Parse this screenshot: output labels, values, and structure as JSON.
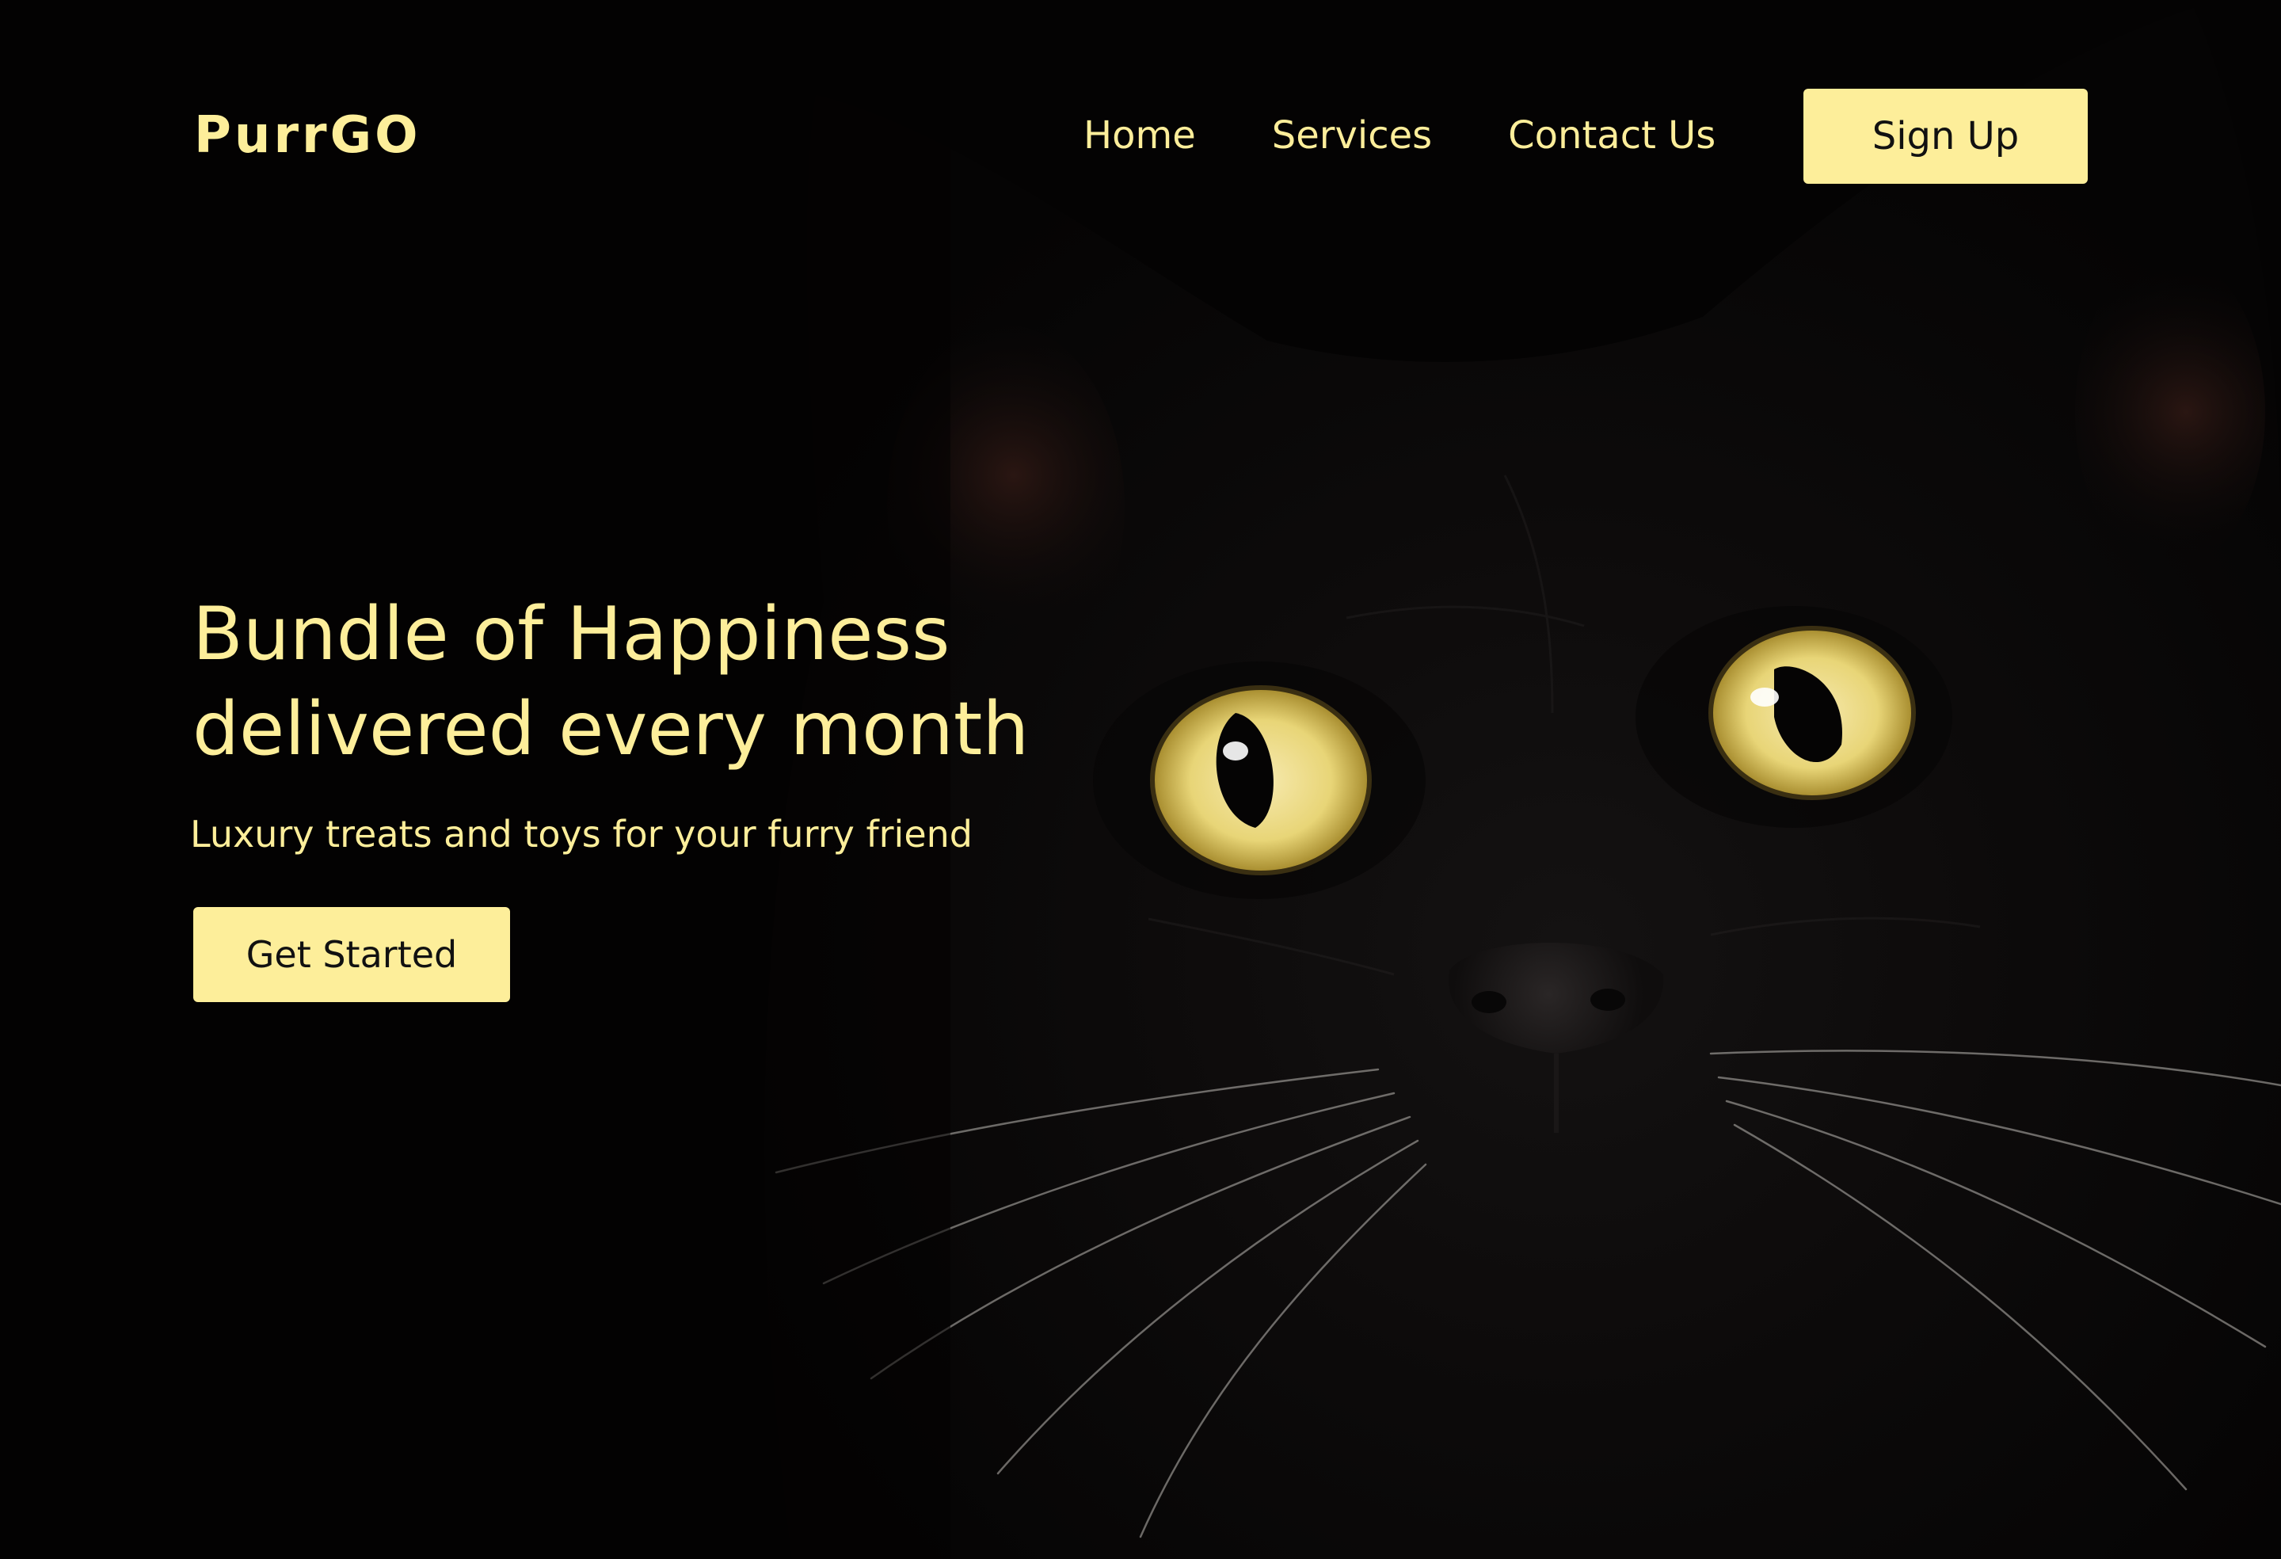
{
  "brand": {
    "name": "PurrGO"
  },
  "nav": {
    "items": [
      {
        "label": "Home"
      },
      {
        "label": "Services"
      },
      {
        "label": "Contact Us"
      }
    ],
    "signup_label": "Sign Up"
  },
  "hero": {
    "title_line1": "Bundle of Happiness",
    "title_line2": "delivered every month",
    "subtitle": "Luxury treats and toys for your furry friend",
    "cta_label": "Get Started"
  },
  "colors": {
    "accent": "#FDEE9A",
    "background": "#040303",
    "eye": "#E9D77A",
    "button_text": "#111111"
  },
  "icons": {
    "hero_image": "black-cat-photo"
  }
}
